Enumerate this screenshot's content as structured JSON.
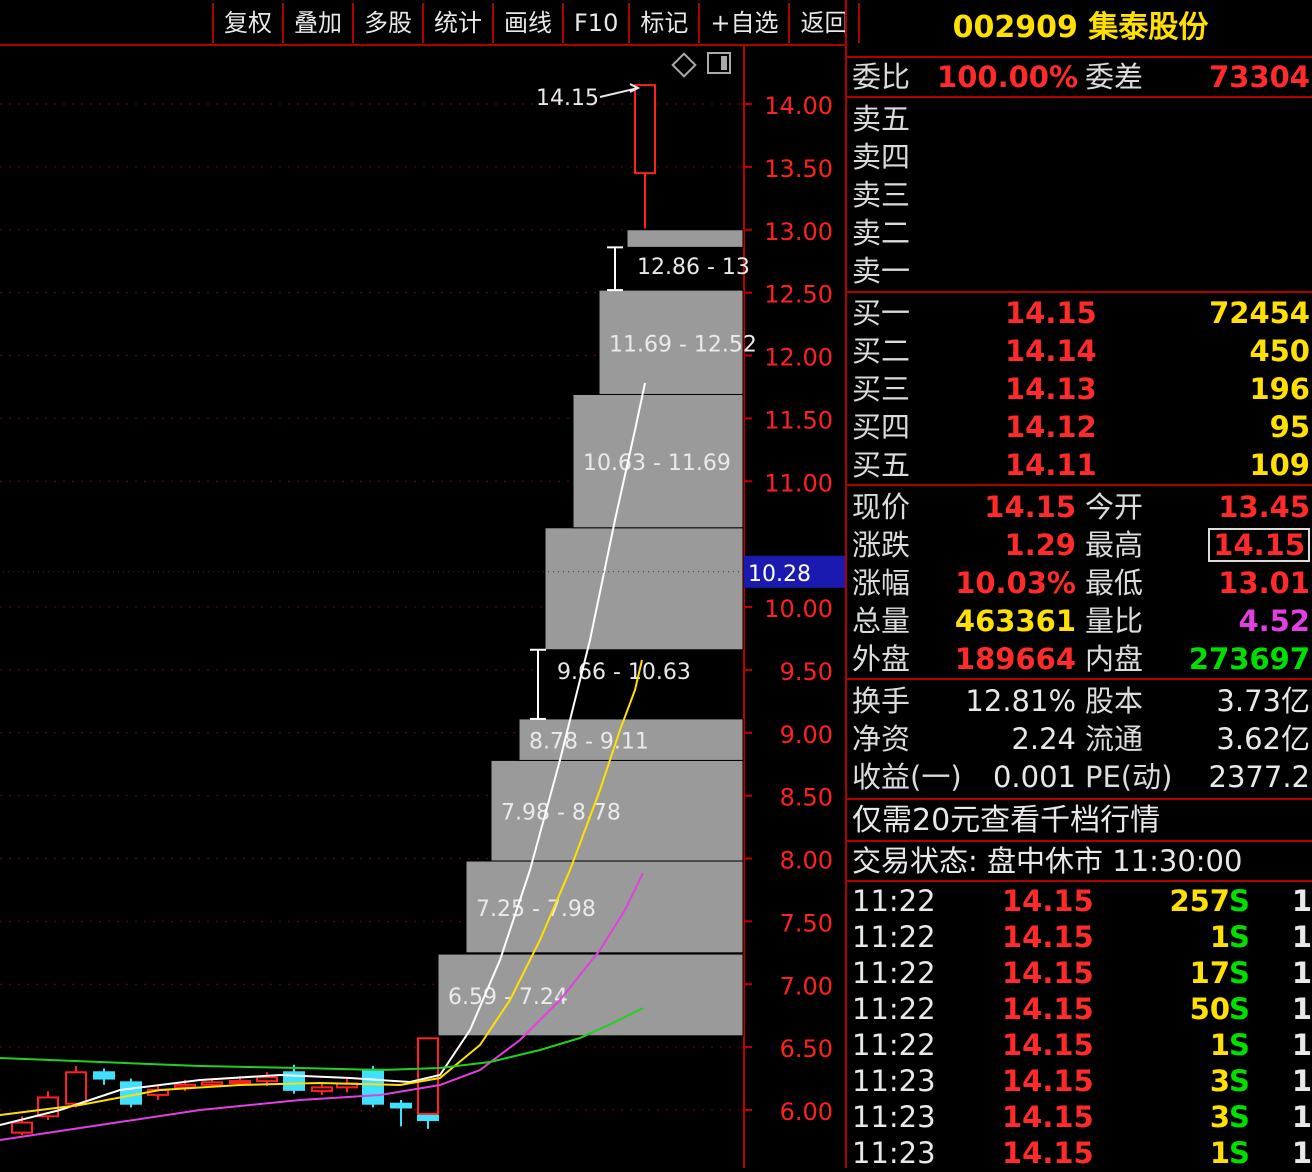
{
  "toolbar": [
    "复权",
    "叠加",
    "多股",
    "统计",
    "画线",
    "F10",
    "标记",
    "+自选",
    "返回"
  ],
  "chart_data": {
    "type": "candlestick",
    "ylim": [
      5.75,
      14.45
    ],
    "y_ticks": [
      "14.00",
      "13.50",
      "13.00",
      "12.50",
      "12.00",
      "11.50",
      "11.00",
      "10.00",
      "9.50",
      "9.00",
      "8.50",
      "8.00",
      "7.50",
      "7.00",
      "6.50",
      "6.00"
    ],
    "y_tick_values": [
      14.0,
      13.5,
      13.0,
      12.5,
      12.0,
      11.5,
      11.0,
      10.0,
      9.5,
      9.0,
      8.5,
      8.0,
      7.5,
      7.0,
      6.5,
      6.0
    ],
    "cursor_price": "10.28",
    "high_annotation": "14.15",
    "candles": [
      {
        "o": 5.82,
        "c": 5.9,
        "h": 5.95,
        "l": 5.8,
        "up": true
      },
      {
        "o": 5.95,
        "c": 6.1,
        "h": 6.15,
        "l": 5.92,
        "up": true
      },
      {
        "o": 6.05,
        "c": 6.3,
        "h": 6.35,
        "l": 6.02,
        "up": true
      },
      {
        "o": 6.3,
        "c": 6.25,
        "h": 6.33,
        "l": 6.2,
        "up": false
      },
      {
        "o": 6.22,
        "c": 6.05,
        "h": 6.25,
        "l": 6.02,
        "up": false
      },
      {
        "o": 6.12,
        "c": 6.16,
        "h": 6.2,
        "l": 6.08,
        "up": true
      },
      {
        "o": 6.18,
        "c": 6.2,
        "h": 6.24,
        "l": 6.15,
        "up": true
      },
      {
        "o": 6.2,
        "c": 6.22,
        "h": 6.25,
        "l": 6.18,
        "up": true
      },
      {
        "o": 6.22,
        "c": 6.23,
        "h": 6.27,
        "l": 6.2,
        "up": true
      },
      {
        "o": 6.23,
        "c": 6.26,
        "h": 6.3,
        "l": 6.19,
        "up": true
      },
      {
        "o": 6.3,
        "c": 6.16,
        "h": 6.36,
        "l": 6.13,
        "up": false
      },
      {
        "o": 6.15,
        "c": 6.18,
        "h": 6.21,
        "l": 6.12,
        "up": true
      },
      {
        "o": 6.18,
        "c": 6.21,
        "h": 6.25,
        "l": 6.14,
        "up": true
      },
      {
        "o": 6.32,
        "c": 6.05,
        "h": 6.35,
        "l": 6.02,
        "up": false
      },
      {
        "o": 6.02,
        "c": 6.05,
        "h": 6.08,
        "l": 5.87,
        "up": false
      },
      {
        "o": 6.0,
        "c": 5.92,
        "h": 6.02,
        "l": 5.85,
        "up": false
      },
      {
        "o": 5.97,
        "c": 6.57,
        "h": 6.57,
        "l": 5.97,
        "up": true
      },
      {
        "o": 13.45,
        "c": 14.15,
        "h": 14.15,
        "l": 13.01,
        "up": true
      }
    ],
    "limit_up_boxes": [
      {
        "low": 6.59,
        "high": 7.24,
        "label": "6.59 - 7.24"
      },
      {
        "low": 7.25,
        "high": 7.98,
        "label": "7.25 - 7.98"
      },
      {
        "low": 7.98,
        "high": 8.78,
        "label": "7.98 - 8.78"
      },
      {
        "low": 8.78,
        "high": 9.11,
        "label": "8.78 - 9.11"
      },
      {
        "low": 9.11,
        "high": 9.66,
        "label": ""
      },
      {
        "low": 9.66,
        "high": 10.63,
        "label": "9.66 - 10.63"
      },
      {
        "low": 10.63,
        "high": 11.69,
        "label": "10.63 - 11.69"
      },
      {
        "low": 11.69,
        "high": 12.52,
        "label": "11.69 - 12.52"
      },
      {
        "low": 12.52,
        "high": 12.86,
        "label": ""
      },
      {
        "low": 12.86,
        "high": 13.0,
        "label": "12.86 - 13"
      }
    ],
    "ma_lines": [
      {
        "name": "MA5",
        "color": "#ffffff"
      },
      {
        "name": "MA10",
        "color": "#ffe000"
      },
      {
        "name": "MA20",
        "color": "#e040e0"
      },
      {
        "name": "MA60",
        "color": "#20d020"
      }
    ]
  },
  "panel": {
    "stock_header": "002909 集泰股份",
    "weibi_label": "委比",
    "weibi_value": "100.00%",
    "weicha_label": "委差",
    "weicha_value": "73304",
    "sell": [
      {
        "label": "卖五"
      },
      {
        "label": "卖四"
      },
      {
        "label": "卖三"
      },
      {
        "label": "卖二"
      },
      {
        "label": "卖一"
      }
    ],
    "buy": [
      {
        "label": "买一",
        "price": "14.15",
        "vol": "72454"
      },
      {
        "label": "买二",
        "price": "14.14",
        "vol": "450"
      },
      {
        "label": "买三",
        "price": "14.13",
        "vol": "196"
      },
      {
        "label": "买四",
        "price": "14.12",
        "vol": "95"
      },
      {
        "label": "买五",
        "price": "14.11",
        "vol": "109"
      }
    ],
    "quote": [
      {
        "l1": "现价",
        "v1": "14.15",
        "c1": "red",
        "l2": "今开",
        "v2": "13.45",
        "c2": "red",
        "boxed": false
      },
      {
        "l1": "涨跌",
        "v1": "1.29",
        "c1": "red",
        "l2": "最高",
        "v2": "14.15",
        "c2": "red",
        "boxed": true
      },
      {
        "l1": "涨幅",
        "v1": "10.03%",
        "c1": "red",
        "l2": "最低",
        "v2": "13.01",
        "c2": "red",
        "boxed": false
      },
      {
        "l1": "总量",
        "v1": "463361",
        "c1": "yellow",
        "l2": "量比",
        "v2": "4.52",
        "c2": "magenta",
        "boxed": false
      },
      {
        "l1": "外盘",
        "v1": "189664",
        "c1": "red",
        "l2": "内盘",
        "v2": "273697",
        "c2": "green",
        "boxed": false
      }
    ],
    "fund": [
      {
        "l1": "换手",
        "v1": "12.81%",
        "l2": "股本",
        "v2": "3.73亿"
      },
      {
        "l1": "净资",
        "v1": "2.24",
        "l2": "流通",
        "v2": "3.62亿"
      },
      {
        "l1": "收益(一)",
        "v1": "0.001",
        "l2": "PE(动)",
        "v2": "2377.2"
      }
    ],
    "banner": "仅需20元查看千档行情",
    "status": "交易状态: 盘中休市 11:30:00",
    "ticks": [
      {
        "time": "11:22",
        "price": "14.15",
        "vol": "257",
        "side": "S",
        "n": "1"
      },
      {
        "time": "11:22",
        "price": "14.15",
        "vol": "1",
        "side": "S",
        "n": "1"
      },
      {
        "time": "11:22",
        "price": "14.15",
        "vol": "17",
        "side": "S",
        "n": "1"
      },
      {
        "time": "11:22",
        "price": "14.15",
        "vol": "50",
        "side": "S",
        "n": "1"
      },
      {
        "time": "11:22",
        "price": "14.15",
        "vol": "1",
        "side": "S",
        "n": "1"
      },
      {
        "time": "11:23",
        "price": "14.15",
        "vol": "3",
        "side": "S",
        "n": "1"
      },
      {
        "time": "11:23",
        "price": "14.15",
        "vol": "3",
        "side": "S",
        "n": "1"
      },
      {
        "time": "11:23",
        "price": "14.15",
        "vol": "1",
        "side": "S",
        "n": "1"
      }
    ]
  }
}
